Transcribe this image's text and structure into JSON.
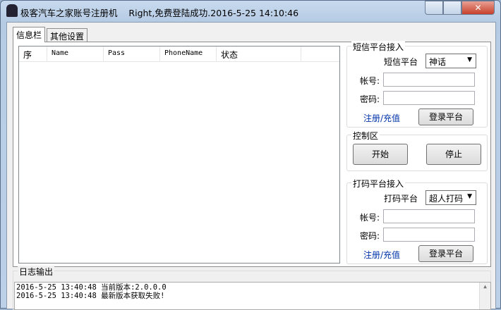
{
  "window": {
    "app_title": "极客汽车之家账号注册机",
    "status_title": "Right,免费登陆成功.2016-5-25 14:10:46"
  },
  "tabs": [
    {
      "label": "信息栏"
    },
    {
      "label": "其他设置"
    }
  ],
  "table": {
    "columns": [
      "序",
      "Name",
      "Pass",
      "PhoneName",
      "状态"
    ],
    "rows": []
  },
  "sms": {
    "group": "短信平台接入",
    "platform_label": "短信平台",
    "platform_value": "神话",
    "account_label": "帐号:",
    "account_value": "",
    "password_label": "密码:",
    "password_value": "",
    "register_link": "注册/充值",
    "login_button": "登录平台"
  },
  "control": {
    "group": "控制区",
    "start_button": "开始",
    "stop_button": "停止"
  },
  "captcha": {
    "group": "打码平台接入",
    "platform_label": "打码平台",
    "platform_value": "超人打码",
    "account_label": "帐号:",
    "account_value": "",
    "password_label": "密码:",
    "password_value": "",
    "register_link": "注册/充值",
    "login_button": "登录平台"
  },
  "log": {
    "title": "日志输出",
    "lines": [
      "2016-5-25 13:40:48 当前版本:2.0.0.0",
      "2016-5-25 13:40:48 最新版本获取失败!"
    ]
  }
}
